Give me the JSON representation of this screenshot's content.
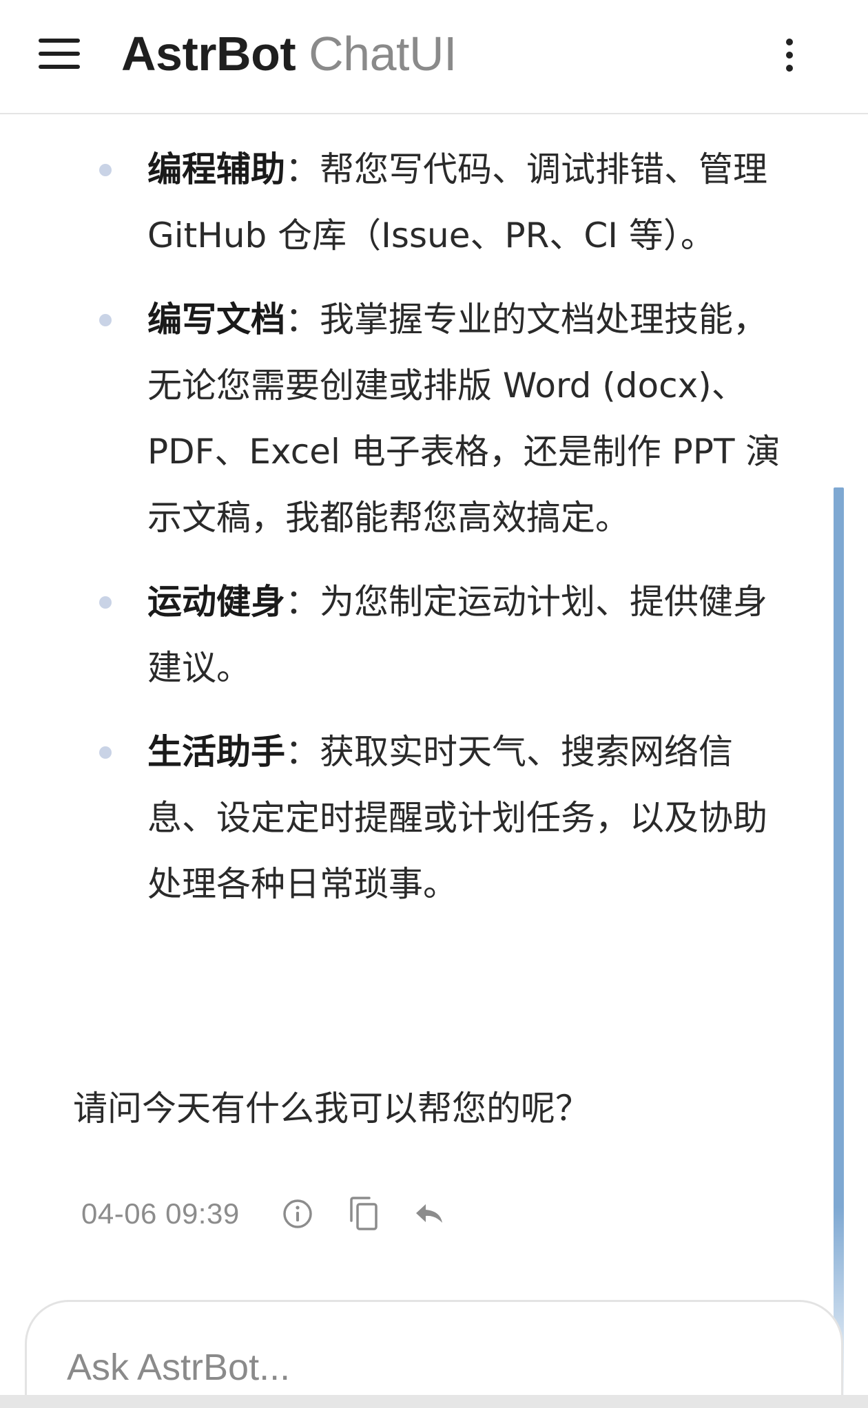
{
  "header": {
    "brand": "AstrBot",
    "sub": " ChatUI"
  },
  "message": {
    "skills": [
      {
        "name": "编程辅助",
        "desc": "：帮您写代码、调试排错、管理 GitHub 仓库（Issue、PR、CI 等）。"
      },
      {
        "name": "编写文档",
        "desc": "：我掌握专业的文档处理技能，无论您需要创建或排版 Word (docx)、PDF、Excel 电子表格，还是制作 PPT 演示文稿，我都能帮您高效搞定。"
      },
      {
        "name": "运动健身",
        "desc": "：为您制定运动计划、提供健身建议。"
      },
      {
        "name": "生活助手",
        "desc": "：获取实时天气、搜索网络信息、设定定时提醒或计划任务，以及协助处理各种日常琐事。"
      }
    ],
    "closing": "请问今天有什么我可以帮您的呢？",
    "timestamp": "04-06 09:39"
  },
  "icons": {
    "menu": "menu-icon",
    "more": "more-vertical-icon",
    "info": "info-icon",
    "copy": "copy-icon",
    "reply": "reply-icon"
  },
  "input": {
    "placeholder": "Ask AstrBot..."
  },
  "colors": {
    "scrollbar": "#7ea8d2",
    "bullet": "#c9d3e6",
    "meta": "#8c8c8c"
  }
}
